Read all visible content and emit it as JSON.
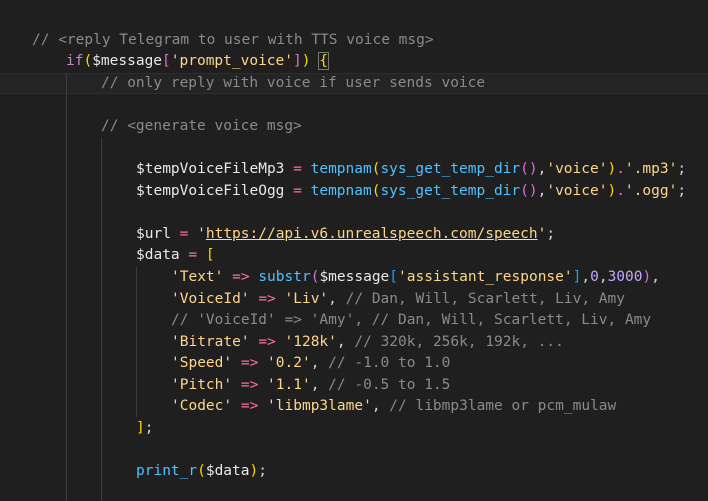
{
  "editor": {
    "language": "php",
    "theme_colors": {
      "background": "#1f1f1f",
      "comment": "#8a8a8a",
      "keyword": "#c586c0",
      "string": "#ffd58a",
      "function": "#4fc1ff",
      "operator": "#ff6fa3",
      "number": "#c6a6ff"
    },
    "lines": {
      "l1": "// <reply Telegram to user with TTS voice msg>",
      "l2_kw": "if",
      "l2_open": "(",
      "l2_var": "$message",
      "l2_bo": "[",
      "l2_key": "'prompt_voice'",
      "l2_bc": "]",
      "l2_close": ")",
      "l2_brace": "{",
      "l3": "// only reply with voice if user sends voice",
      "l4": "// <generate voice msg>",
      "l5_var": "$tempVoiceFileMp3",
      "l5_eq": "=",
      "l5_fn": "tempnam",
      "l5_p1": "(",
      "l5_fn2": "sys_get_temp_dir",
      "l5_p2": "()",
      "l5_comma": ",",
      "l5_str": "'voice'",
      "l5_p3": ")",
      "l5_dot": ".",
      "l5_ext": "'.mp3'",
      "l5_semi": ";",
      "l6_var": "$tempVoiceFileOgg",
      "l6_eq": "=",
      "l6_fn": "tempnam",
      "l6_p1": "(",
      "l6_fn2": "sys_get_temp_dir",
      "l6_p2": "()",
      "l6_comma": ",",
      "l6_str": "'voice'",
      "l6_p3": ")",
      "l6_dot": ".",
      "l6_ext": "'.ogg'",
      "l6_semi": ";",
      "l7_var": "$url",
      "l7_eq": "=",
      "l7_q1": "'",
      "l7_url": "https://api.v6.unrealspeech.com/speech",
      "l7_q2": "'",
      "l7_semi": ";",
      "l8_var": "$data",
      "l8_eq": "=",
      "l8_open": "[",
      "l9_key": "'Text'",
      "l9_arrow": "=>",
      "l9_fn": "substr",
      "l9_p1": "(",
      "l9_var": "$message",
      "l9_bo": "[",
      "l9_str": "'assistant_response'",
      "l9_bc": "]",
      "l9_c1": ",",
      "l9_n1": "0",
      "l9_c2": ",",
      "l9_n2": "3000",
      "l9_p2": ")",
      "l9_comma": ",",
      "l10_key": "'VoiceId'",
      "l10_arrow": "=>",
      "l10_val": "'Liv'",
      "l10_comma": ",",
      "l10_comment": "// Dan, Will, Scarlett, Liv, Amy",
      "l11_comment": "// 'VoiceId' => 'Amy', // Dan, Will, Scarlett, Liv, Amy",
      "l12_key": "'Bitrate'",
      "l12_arrow": "=>",
      "l12_val": "'128k'",
      "l12_comma": ",",
      "l12_comment": "// 320k, 256k, 192k, ...",
      "l13_key": "'Speed'",
      "l13_arrow": "=>",
      "l13_val": "'0.2'",
      "l13_comma": ",",
      "l13_comment": "// -1.0 to 1.0",
      "l14_key": "'Pitch'",
      "l14_arrow": "=>",
      "l14_val": "'1.1'",
      "l14_comma": ",",
      "l14_comment": "// -0.5 to 1.5",
      "l15_key": "'Codec'",
      "l15_arrow": "=>",
      "l15_val": "'libmp3lame'",
      "l15_comma": ",",
      "l15_comment": "// libmp3lame or pcm_mulaw",
      "l16_close": "]",
      "l16_semi": ";",
      "l17_fn": "print_r",
      "l17_p1": "(",
      "l17_var": "$data",
      "l17_p2": ")",
      "l17_semi": ";"
    }
  }
}
